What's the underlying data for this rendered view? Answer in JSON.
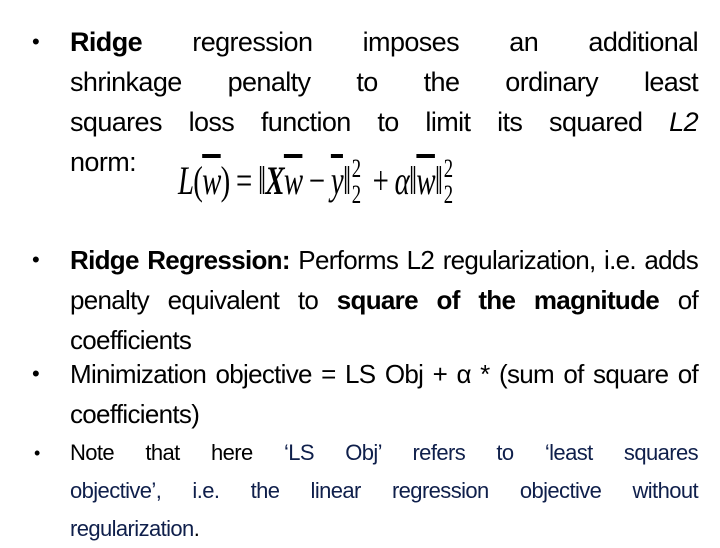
{
  "slide": {
    "bullets": [
      {
        "lines": [
          {
            "bold": "Ridge",
            "text": " regression imposes an additional"
          },
          {
            "text": "shrinkage penalty to the ordinary least"
          },
          {
            "text": "squares loss function to limit its squared ",
            "italic": "L2"
          },
          {
            "text": "norm:"
          }
        ]
      },
      {
        "bold_lead": "Ridge Regression:",
        "text_1": " Performs L2 regularization, i.e. adds penalty equivalent to ",
        "bold_mid": "square of the magnitude",
        "text_2": " of coefficients"
      },
      {
        "text": "Minimization objective = LS Obj + α * (sum of square of coefficients)"
      },
      {
        "line_1_black": "Note that here ",
        "line_1_navy": "‘LS Obj’ refers to ‘least squares",
        "line_2": "objective’, i.e. the linear regression objective without",
        "line_3": "regularization",
        "line_3_end": "."
      }
    ],
    "formula": {
      "lhs_fn": "L",
      "var_w": "w",
      "open_paren": "(",
      "close_paren": ")",
      "equals": " = ",
      "norm_bar": "‖",
      "matrix_x": "X",
      "minus": " − ",
      "var_y": "y",
      "plus": " + ",
      "alpha": "α",
      "sup": "2",
      "sub": "2"
    },
    "colors": {
      "text": "#000000",
      "note_text": "#0f1f4b",
      "background": "#ffffff"
    }
  }
}
